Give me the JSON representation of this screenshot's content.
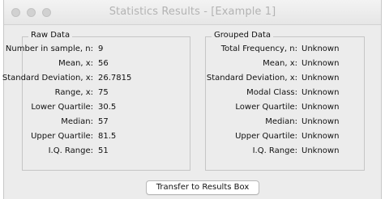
{
  "window": {
    "title": "Statistics Results - [Example 1]"
  },
  "raw_data": {
    "title": "Raw Data",
    "rows": [
      {
        "label": "Number in sample, n:",
        "value": "9"
      },
      {
        "label": "Mean, x:",
        "value": "56"
      },
      {
        "label": "Standard Deviation, x:",
        "value": "26.7815"
      },
      {
        "label": "Range, x:",
        "value": "75"
      },
      {
        "label": "Lower Quartile:",
        "value": "30.5"
      },
      {
        "label": "Median:",
        "value": "57"
      },
      {
        "label": "Upper Quartile:",
        "value": "81.5"
      },
      {
        "label": "I.Q. Range:",
        "value": "51"
      }
    ]
  },
  "grouped_data": {
    "title": "Grouped Data",
    "rows": [
      {
        "label": "Total Frequency, n:",
        "value": "Unknown"
      },
      {
        "label": "Mean, x:",
        "value": "Unknown"
      },
      {
        "label": "Standard Deviation, x:",
        "value": "Unknown"
      },
      {
        "label": "Modal Class:",
        "value": "Unknown"
      },
      {
        "label": "Lower Quartile:",
        "value": "Unknown"
      },
      {
        "label": "Median:",
        "value": "Unknown"
      },
      {
        "label": "Upper Quartile:",
        "value": "Unknown"
      },
      {
        "label": "I.Q. Range:",
        "value": "Unknown"
      }
    ]
  },
  "actions": {
    "transfer_label": "Transfer to Results Box"
  }
}
